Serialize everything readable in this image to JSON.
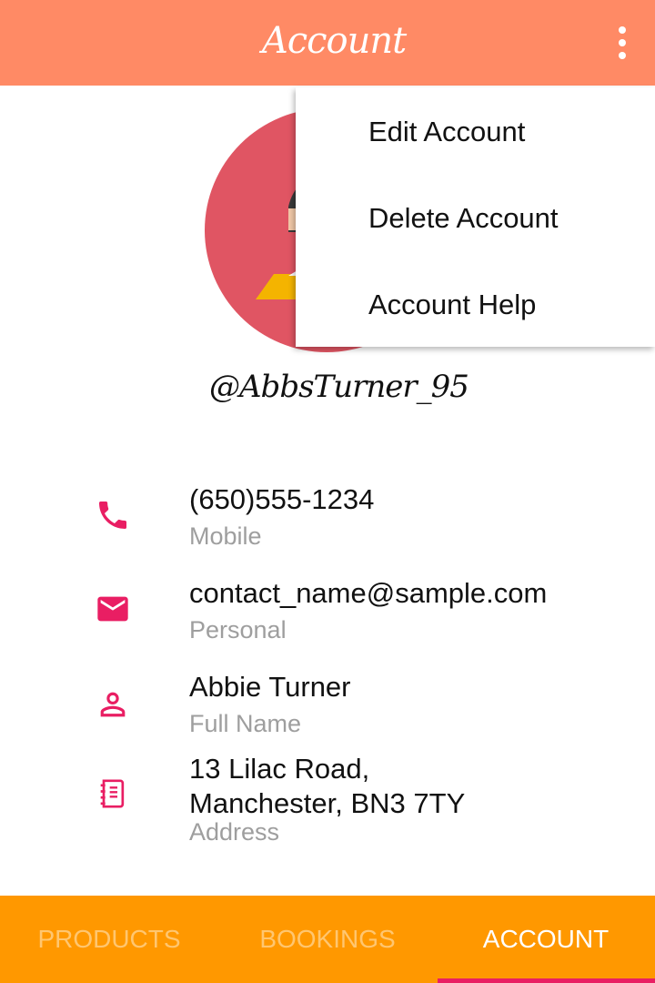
{
  "header": {
    "title": "Account",
    "menu_icon": "more-vert-icon"
  },
  "profile": {
    "handle": "@AbbsTurner_95"
  },
  "overflow_menu": {
    "items": [
      {
        "label": "Edit Account"
      },
      {
        "label": "Delete Account"
      },
      {
        "label": "Account Help"
      }
    ]
  },
  "details": [
    {
      "icon": "phone-icon",
      "value": "(650)555-1234",
      "label": "Mobile"
    },
    {
      "icon": "email-icon",
      "value": "contact_name@sample.com",
      "label": "Personal"
    },
    {
      "icon": "person-icon",
      "value": "Abbie Turner",
      "label": "Full Name"
    },
    {
      "icon": "address-book-icon",
      "value": "13 Lilac Road,\nManchester, BN3 7TY",
      "label": "Address"
    }
  ],
  "tabs": [
    {
      "label": "PRODUCTS",
      "active": false
    },
    {
      "label": "BOOKINGS",
      "active": false
    },
    {
      "label": "ACCOUNT",
      "active": true
    }
  ],
  "colors": {
    "appbar": "#ff8a65",
    "tabbar": "#ff9800",
    "accent": "#e91e63",
    "avatar_bg": "#e05563"
  }
}
